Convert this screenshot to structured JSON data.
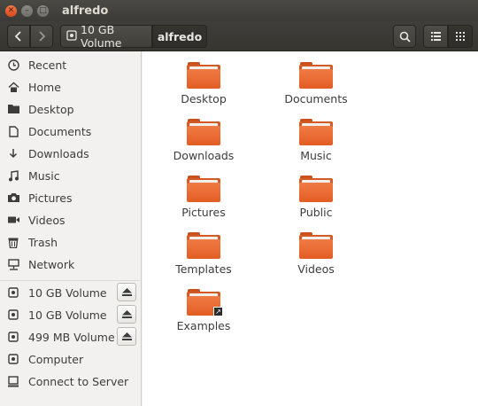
{
  "window": {
    "title": "alfredo"
  },
  "path": {
    "volume": "10 GB Volume",
    "current": "alfredo"
  },
  "sidebar": {
    "places": [
      {
        "label": "Recent",
        "icon": "clock-icon"
      },
      {
        "label": "Home",
        "icon": "home-icon"
      },
      {
        "label": "Desktop",
        "icon": "desktop-folder-icon"
      },
      {
        "label": "Documents",
        "icon": "document-icon"
      },
      {
        "label": "Downloads",
        "icon": "download-icon"
      },
      {
        "label": "Music",
        "icon": "music-icon"
      },
      {
        "label": "Pictures",
        "icon": "camera-icon"
      },
      {
        "label": "Videos",
        "icon": "video-icon"
      },
      {
        "label": "Trash",
        "icon": "trash-icon"
      },
      {
        "label": "Network",
        "icon": "network-icon"
      }
    ],
    "devices": [
      {
        "label": "10 GB Volume",
        "icon": "drive-icon",
        "ejectable": true
      },
      {
        "label": "10 GB Volume",
        "icon": "drive-icon",
        "ejectable": true
      },
      {
        "label": "499 MB Volume",
        "icon": "drive-icon",
        "ejectable": true
      },
      {
        "label": "Computer",
        "icon": "drive-icon",
        "ejectable": false
      },
      {
        "label": "Connect to Server",
        "icon": "server-icon",
        "ejectable": false
      }
    ]
  },
  "files": [
    {
      "label": "Desktop",
      "link": false
    },
    {
      "label": "Documents",
      "link": false
    },
    {
      "label": "Downloads",
      "link": false
    },
    {
      "label": "Music",
      "link": false
    },
    {
      "label": "Pictures",
      "link": false
    },
    {
      "label": "Public",
      "link": false
    },
    {
      "label": "Templates",
      "link": false
    },
    {
      "label": "Videos",
      "link": false
    },
    {
      "label": "Examples",
      "link": true
    }
  ],
  "colors": {
    "accent": "#e95420",
    "folder": "#e25d23"
  }
}
